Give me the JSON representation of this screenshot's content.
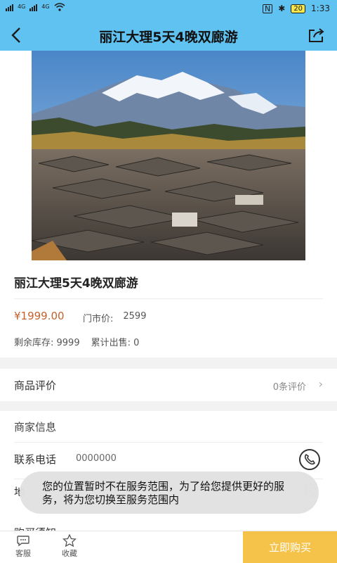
{
  "status_bar": {
    "network_1": "4G",
    "network_2": "4G",
    "battery": "20",
    "time": "1:33"
  },
  "header": {
    "title": "丽江大理5天4晚双廊游",
    "back_icon": "back-arrow-icon",
    "share_icon": "share-icon",
    "bg_color": "#5fc2f1"
  },
  "product": {
    "name": "丽江大理5天4晚双廊游",
    "price": "¥1999.00",
    "market_price_label": "门市价:",
    "market_price": "2599",
    "stock_label": "剩余库存: 9999",
    "sold_label": "累计出售: 0",
    "price_color": "#c6612d"
  },
  "reviews": {
    "label": "商品评价",
    "count": "0条评价"
  },
  "merchant": {
    "title": "商家信息",
    "phone_label": "联系电话",
    "phone_value": "0000000",
    "address_fragment": "地",
    "notice_fragment": "购买须知"
  },
  "toast": {
    "message": "您的位置暂时不在服务范围，为了给您提供更好的服务，将为您切换至服务范围内"
  },
  "bottom_bar": {
    "service_label": "客服",
    "favorite_label": "收藏",
    "buy_label": "立即购买",
    "buy_color": "#f5c34a"
  }
}
